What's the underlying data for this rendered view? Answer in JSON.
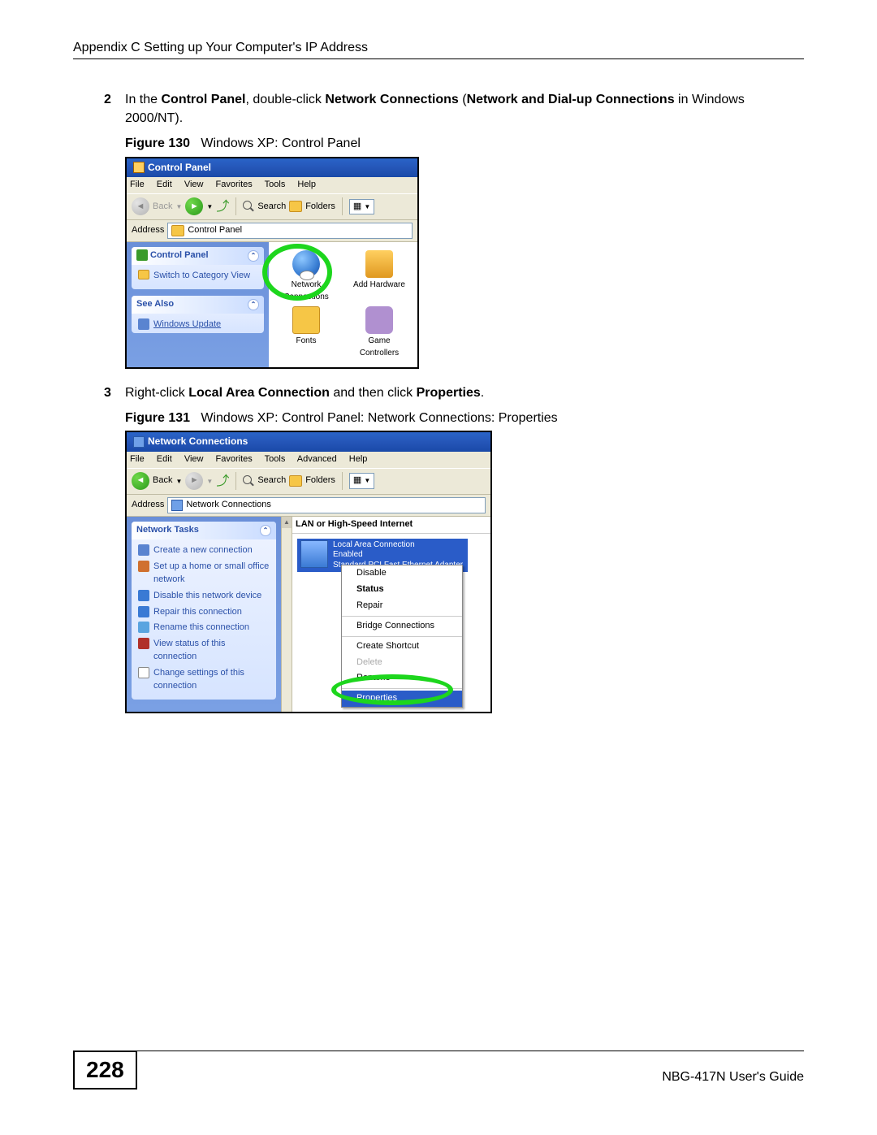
{
  "header": {
    "section": "Appendix C Setting up Your Computer's IP Address"
  },
  "step2": {
    "num": "2",
    "pre": "In the ",
    "b1": "Control Panel",
    "mid1": ", double-click ",
    "b2": "Network Connections",
    "mid2": " (",
    "b3": "Network and Dial-up Connections",
    "mid3": " in Windows 2000/NT).",
    "fig_label": "Figure 130",
    "fig_caption": "Windows XP: Control Panel"
  },
  "shot1": {
    "title": "Control Panel",
    "menu": [
      "File",
      "Edit",
      "View",
      "Favorites",
      "Tools",
      "Help"
    ],
    "back": "Back",
    "search": "Search",
    "folders": "Folders",
    "address_label": "Address",
    "address_value": "Control Panel",
    "side_title": "Control Panel",
    "side_switch": "Switch to Category View",
    "see_also": "See Also",
    "win_update": "Windows Update",
    "icons": {
      "net": "Network Connections",
      "add_hw": "Add Hardware",
      "fonts": "Fonts",
      "game": "Game Controllers"
    }
  },
  "step3": {
    "num": "3",
    "pre": "Right-click ",
    "b1": "Local Area Connection",
    "mid1": " and then click ",
    "b2": "Properties",
    "post": ".",
    "fig_label": "Figure 131",
    "fig_caption": "Windows XP: Control Panel: Network Connections: Properties"
  },
  "shot2": {
    "title": "Network Connections",
    "menu": [
      "File",
      "Edit",
      "View",
      "Favorites",
      "Tools",
      "Advanced",
      "Help"
    ],
    "back": "Back",
    "search": "Search",
    "folders": "Folders",
    "address_label": "Address",
    "address_value": "Network Connections",
    "side_title": "Network Tasks",
    "tasks": [
      "Create a new connection",
      "Set up a home or small office network",
      "Disable this network device",
      "Repair this connection",
      "Rename this connection",
      "View status of this connection",
      "Change settings of this connection"
    ],
    "section": "LAN or High-Speed Internet",
    "conn_name": "Local Area Connection",
    "conn_status": "Enabled",
    "conn_adapter": "Standard PCI Fast Ethernet Adapter",
    "ctx": {
      "disable": "Disable",
      "status": "Status",
      "repair": "Repair",
      "bridge": "Bridge Connections",
      "shortcut": "Create Shortcut",
      "delete": "Delete",
      "rename": "Rename",
      "properties": "Properties"
    }
  },
  "footer": {
    "page": "228",
    "guide": "NBG-417N User's Guide"
  }
}
